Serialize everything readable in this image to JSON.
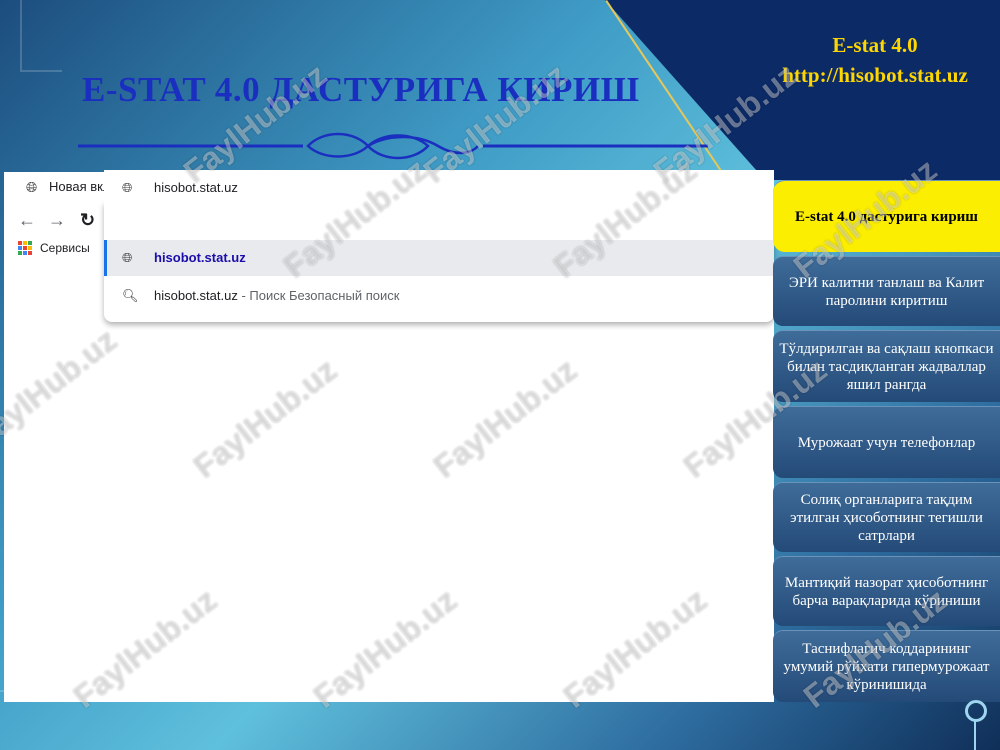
{
  "header": {
    "title": "E-STAT 4.0 ДАСТУРИГА КИРИШ",
    "app_name": "E-stat 4.0",
    "url": "http://hisobot.stat.uz"
  },
  "browser": {
    "tab_title": "Новая вкладка",
    "address_text": "hisobot.stat.uz",
    "bookmark_label": "Сервисы",
    "suggestions": [
      {
        "text": "hisobot.stat.uz"
      },
      {
        "text": "hisobot.stat.uz",
        "suffix": " - Поиск Безопасный поиск"
      }
    ]
  },
  "menu": {
    "items": [
      {
        "label": "E-stat 4.0 дастурига кириш"
      },
      {
        "label": "ЭРИ калитни танлаш ва Калит паролини киритиш"
      },
      {
        "label": "Тўлдирилган ва сақлаш кнопкаси билан тасдиқланган жадваллар яшил рангда"
      },
      {
        "label": "Мурожаат учун телефонлар"
      },
      {
        "label": "Солиқ органларига тақдим этилган ҳисоботнинг тегишли сатрлари"
      },
      {
        "label": "Мантиқий назорат ҳисоботнинг барча варақларида кўриниши"
      },
      {
        "label": "Таснифлагич коддарининг умумий рўйхати гипермурожаат кўринишида"
      }
    ]
  },
  "watermark": "FaylHub.uz",
  "colors": {
    "accent_title": "#1a2fbf",
    "active_item": "#fbee00",
    "estat_gold": "#ffd700"
  }
}
